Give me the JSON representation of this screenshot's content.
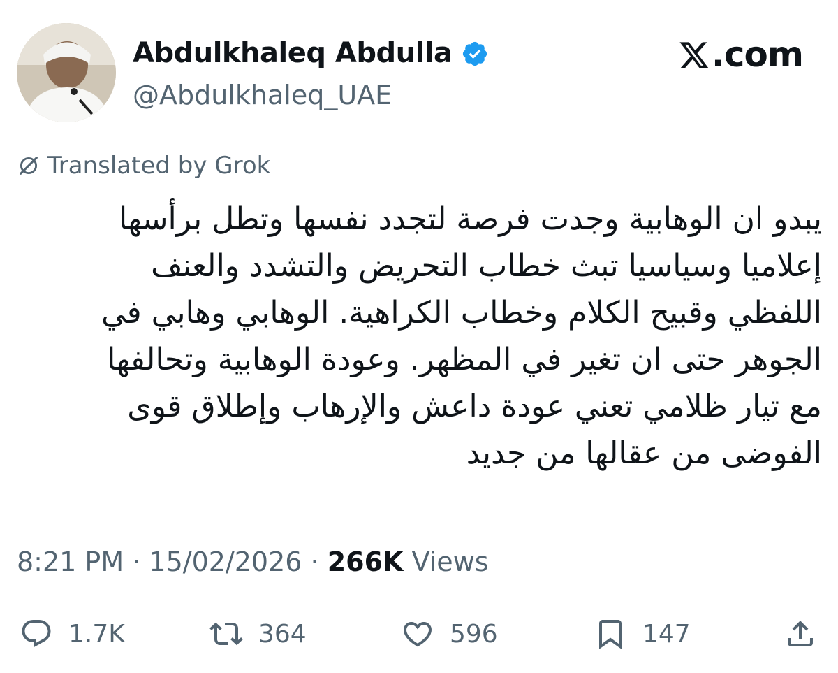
{
  "author": {
    "display_name": "Abdulkhaleq Abdulla",
    "handle": "@Abdulkhaleq_UAE",
    "avatar_icon": "profile-photo",
    "verified_icon": "verified-badge-icon",
    "verified_color": "#1d9bf0"
  },
  "brand": {
    "logo_icon": "x-logo-icon",
    "suffix": ".com"
  },
  "translation": {
    "icon": "grok-icon",
    "label": "Translated by Grok"
  },
  "tweet": {
    "lines": [
      "يبدو ان الوهابية وجدت فرصة لتجدد نفسها وتطل برأسها",
      "إعلاميا وسياسيا تبث خطاب التحريض والتشدد والعنف",
      "اللفظي وقبيح الكلام وخطاب الكراهية. الوهابي وهابي في",
      "الجوهر حتى ان تغير في المظهر. وعودة الوهابية وتحالفها",
      "مع تيار ظلامي تعني عودة داعش والإرهاب وإطلاق قوى",
      "الفوضى من عقالها من جديد"
    ]
  },
  "meta": {
    "time": "8:21 PM",
    "separator": "·",
    "date": "15/02/2026",
    "views_count": "266K",
    "views_label": "Views"
  },
  "actions": {
    "reply": {
      "icon": "reply-icon",
      "count": "1.7K"
    },
    "repost": {
      "icon": "repost-icon",
      "count": "364"
    },
    "like": {
      "icon": "heart-icon",
      "count": "596"
    },
    "bookmark": {
      "icon": "bookmark-icon",
      "count": "147"
    },
    "share": {
      "icon": "share-icon"
    }
  },
  "colors": {
    "text_primary": "#0f1419",
    "text_secondary": "#536471"
  }
}
